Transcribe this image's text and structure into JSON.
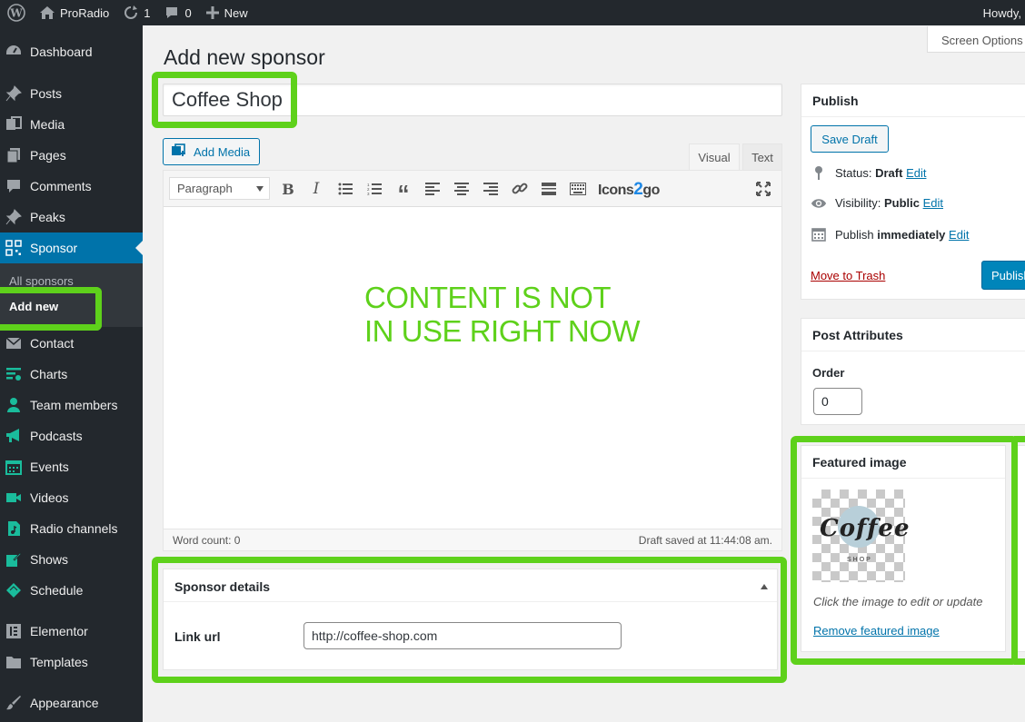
{
  "adminbar": {
    "site_name": "ProRadio",
    "updates_count": "1",
    "comments_count": "0",
    "new_label": "New",
    "howdy": "Howdy,"
  },
  "sidebar": {
    "items": [
      {
        "label": "Dashboard",
        "icon": "dashboard-icon"
      },
      {
        "label": "Posts",
        "icon": "pin-icon"
      },
      {
        "label": "Media",
        "icon": "media-icon"
      },
      {
        "label": "Pages",
        "icon": "pages-icon"
      },
      {
        "label": "Comments",
        "icon": "comment-icon"
      },
      {
        "label": "Peaks",
        "icon": "pin-icon"
      },
      {
        "label": "Sponsor",
        "icon": "qr-icon"
      },
      {
        "label": "Contact",
        "icon": "envelope-icon"
      },
      {
        "label": "Charts",
        "icon": "charts-icon"
      },
      {
        "label": "Team members",
        "icon": "person-icon"
      },
      {
        "label": "Podcasts",
        "icon": "megaphone-icon"
      },
      {
        "label": "Events",
        "icon": "calendar-icon"
      },
      {
        "label": "Videos",
        "icon": "video-camera-icon"
      },
      {
        "label": "Radio channels",
        "icon": "music-file-icon"
      },
      {
        "label": "Shows",
        "icon": "edit-icon"
      },
      {
        "label": "Schedule",
        "icon": "ticket-icon"
      },
      {
        "label": "Elementor",
        "icon": "elementor-icon"
      },
      {
        "label": "Templates",
        "icon": "folder-icon"
      },
      {
        "label": "Appearance",
        "icon": "brush-icon"
      }
    ],
    "submenu": {
      "all_sponsors": "All sponsors",
      "add_new": "Add new"
    }
  },
  "main": {
    "page_title": "Add new sponsor",
    "screen_options": "Screen Options",
    "title_value": "Coffee Shop",
    "add_media": "Add Media",
    "tab_visual": "Visual",
    "tab_text": "Text",
    "format_select": "Paragraph",
    "icons2go_a": "Icons",
    "icons2go_b": "2",
    "icons2go_c": "go",
    "content_note_line1": "CONTENT IS NOT",
    "content_note_line2": "IN USE RIGHT NOW",
    "word_count": "Word count: 0",
    "draft_saved": "Draft saved at 11:44:08 am."
  },
  "sponsor_details": {
    "title": "Sponsor details",
    "link_label": "Link url",
    "link_value": "http://coffee-shop.com"
  },
  "publish": {
    "title": "Publish",
    "save_draft": "Save Draft",
    "status_label": "Status:",
    "status_value": "Draft",
    "visibility_label": "Visibility:",
    "visibility_value": "Public",
    "publish_label": "Publish",
    "publish_value": "immediately",
    "edit": "Edit",
    "move_to_trash": "Move to Trash",
    "publish_button": "Publish"
  },
  "post_attributes": {
    "title": "Post Attributes",
    "order_label": "Order",
    "order_value": "0"
  },
  "featured_image": {
    "title": "Featured image",
    "image_text": "Coffee",
    "image_subtext": "SHOP",
    "hint": "Click the image to edit or update",
    "remove": "Remove featured image"
  },
  "colors": {
    "highlight": "#5ed11b",
    "admin_dark": "#23282d",
    "accent": "#0073aa"
  }
}
